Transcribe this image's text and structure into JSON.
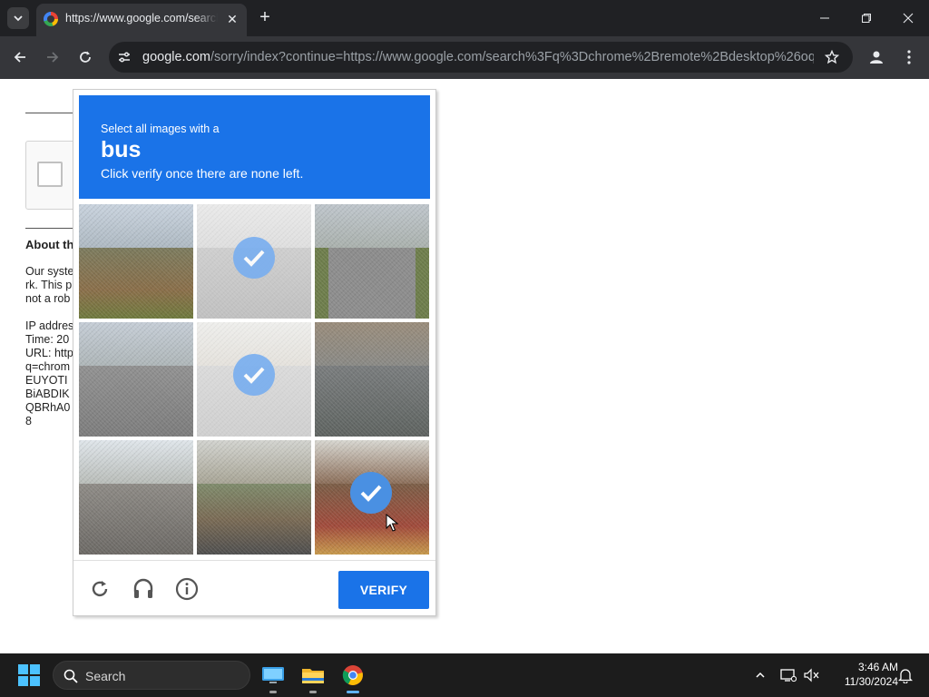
{
  "browser": {
    "tab_title": "https://www.google.com/search?q=chrome",
    "url_host": "google.com",
    "url_path": "/sorry/index?continue=https://www.google.com/search%3Fq%3Dchrome%2Bremote%2Bdesktop%26oq..."
  },
  "page": {
    "about_title": "About th",
    "about_lines": [
      "Our syste",
      "rk. This p",
      "not a rob",
      "",
      "IP addres",
      "Time: 20",
      "URL: http",
      "q=chrom",
      "EUYOTI",
      "BiABDIK",
      "QBRhA0",
      "8"
    ]
  },
  "captcha": {
    "instruction_line1": "Select all images with a",
    "target_word": "bus",
    "instruction_line3": "Click verify once there are none left.",
    "tiles": [
      {
        "name": "tile-1",
        "selected": false
      },
      {
        "name": "tile-2",
        "selected": true,
        "state": "fading"
      },
      {
        "name": "tile-3",
        "selected": false
      },
      {
        "name": "tile-4",
        "selected": false
      },
      {
        "name": "tile-5",
        "selected": true,
        "state": "fading"
      },
      {
        "name": "tile-6",
        "selected": false
      },
      {
        "name": "tile-7",
        "selected": false
      },
      {
        "name": "tile-8",
        "selected": false
      },
      {
        "name": "tile-9",
        "selected": true,
        "state": "selected"
      }
    ],
    "verify_label": "VERIFY",
    "footer_icons": [
      "reload-icon",
      "headphones-icon",
      "info-icon"
    ]
  },
  "taskbar": {
    "search_placeholder": "Search",
    "time": "3:46 AM",
    "date": "11/30/2024"
  },
  "colors": {
    "accent": "#1a73e8",
    "check": "#4a90e2",
    "chrome_dark": "#202124",
    "taskbar": "#1c1c1c"
  }
}
